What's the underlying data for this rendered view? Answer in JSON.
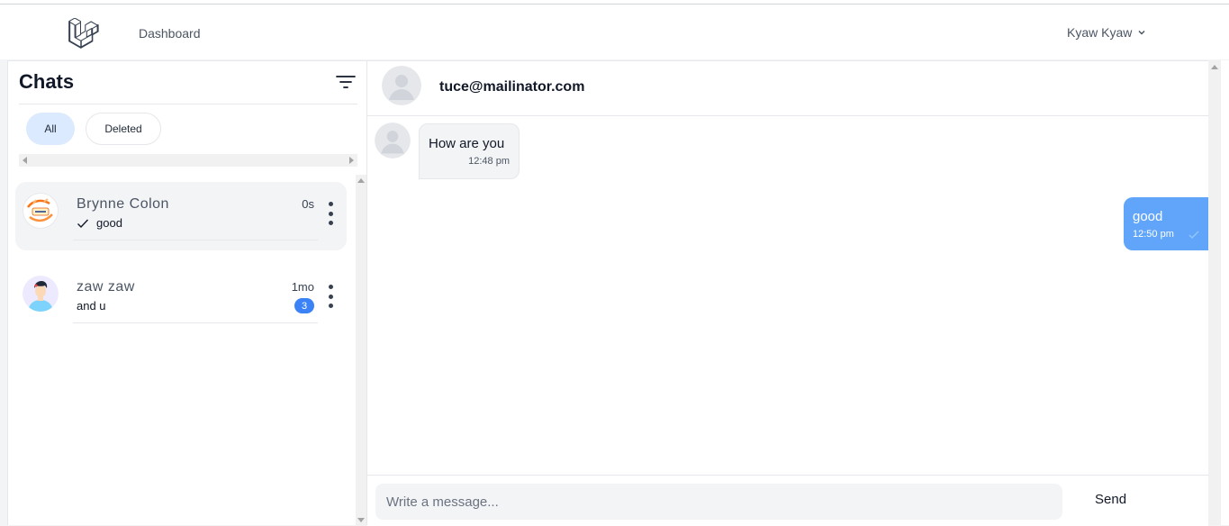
{
  "nav": {
    "logo_icon": "laravel-logo-icon",
    "dashboard_label": "Dashboard",
    "user_name": "Kyaw Kyaw"
  },
  "sidebar": {
    "title": "Chats",
    "filter_icon": "filter-icon",
    "tabs": [
      {
        "label": "All",
        "active": true
      },
      {
        "label": "Deleted",
        "active": false
      }
    ],
    "conversations": [
      {
        "name": "Brynne Colon",
        "time": "0s",
        "preview": "good",
        "read_receipt": true,
        "unread": null,
        "active": true
      },
      {
        "name": "zaw zaw",
        "time": "1mo",
        "preview": "and u",
        "read_receipt": false,
        "unread": "3",
        "active": false
      }
    ]
  },
  "thread": {
    "contact": "tuce@mailinator.com",
    "messages": [
      {
        "direction": "in",
        "text": "How are you",
        "time": "12:48 pm"
      },
      {
        "direction": "out",
        "text": "good",
        "time": "12:50 pm"
      }
    ],
    "composer_placeholder": "Write a message...",
    "send_label": "Send"
  },
  "colors": {
    "accent": "#3b82f6",
    "outgoing_bubble": "#60a5fa",
    "active_tab": "#dbeafe"
  }
}
